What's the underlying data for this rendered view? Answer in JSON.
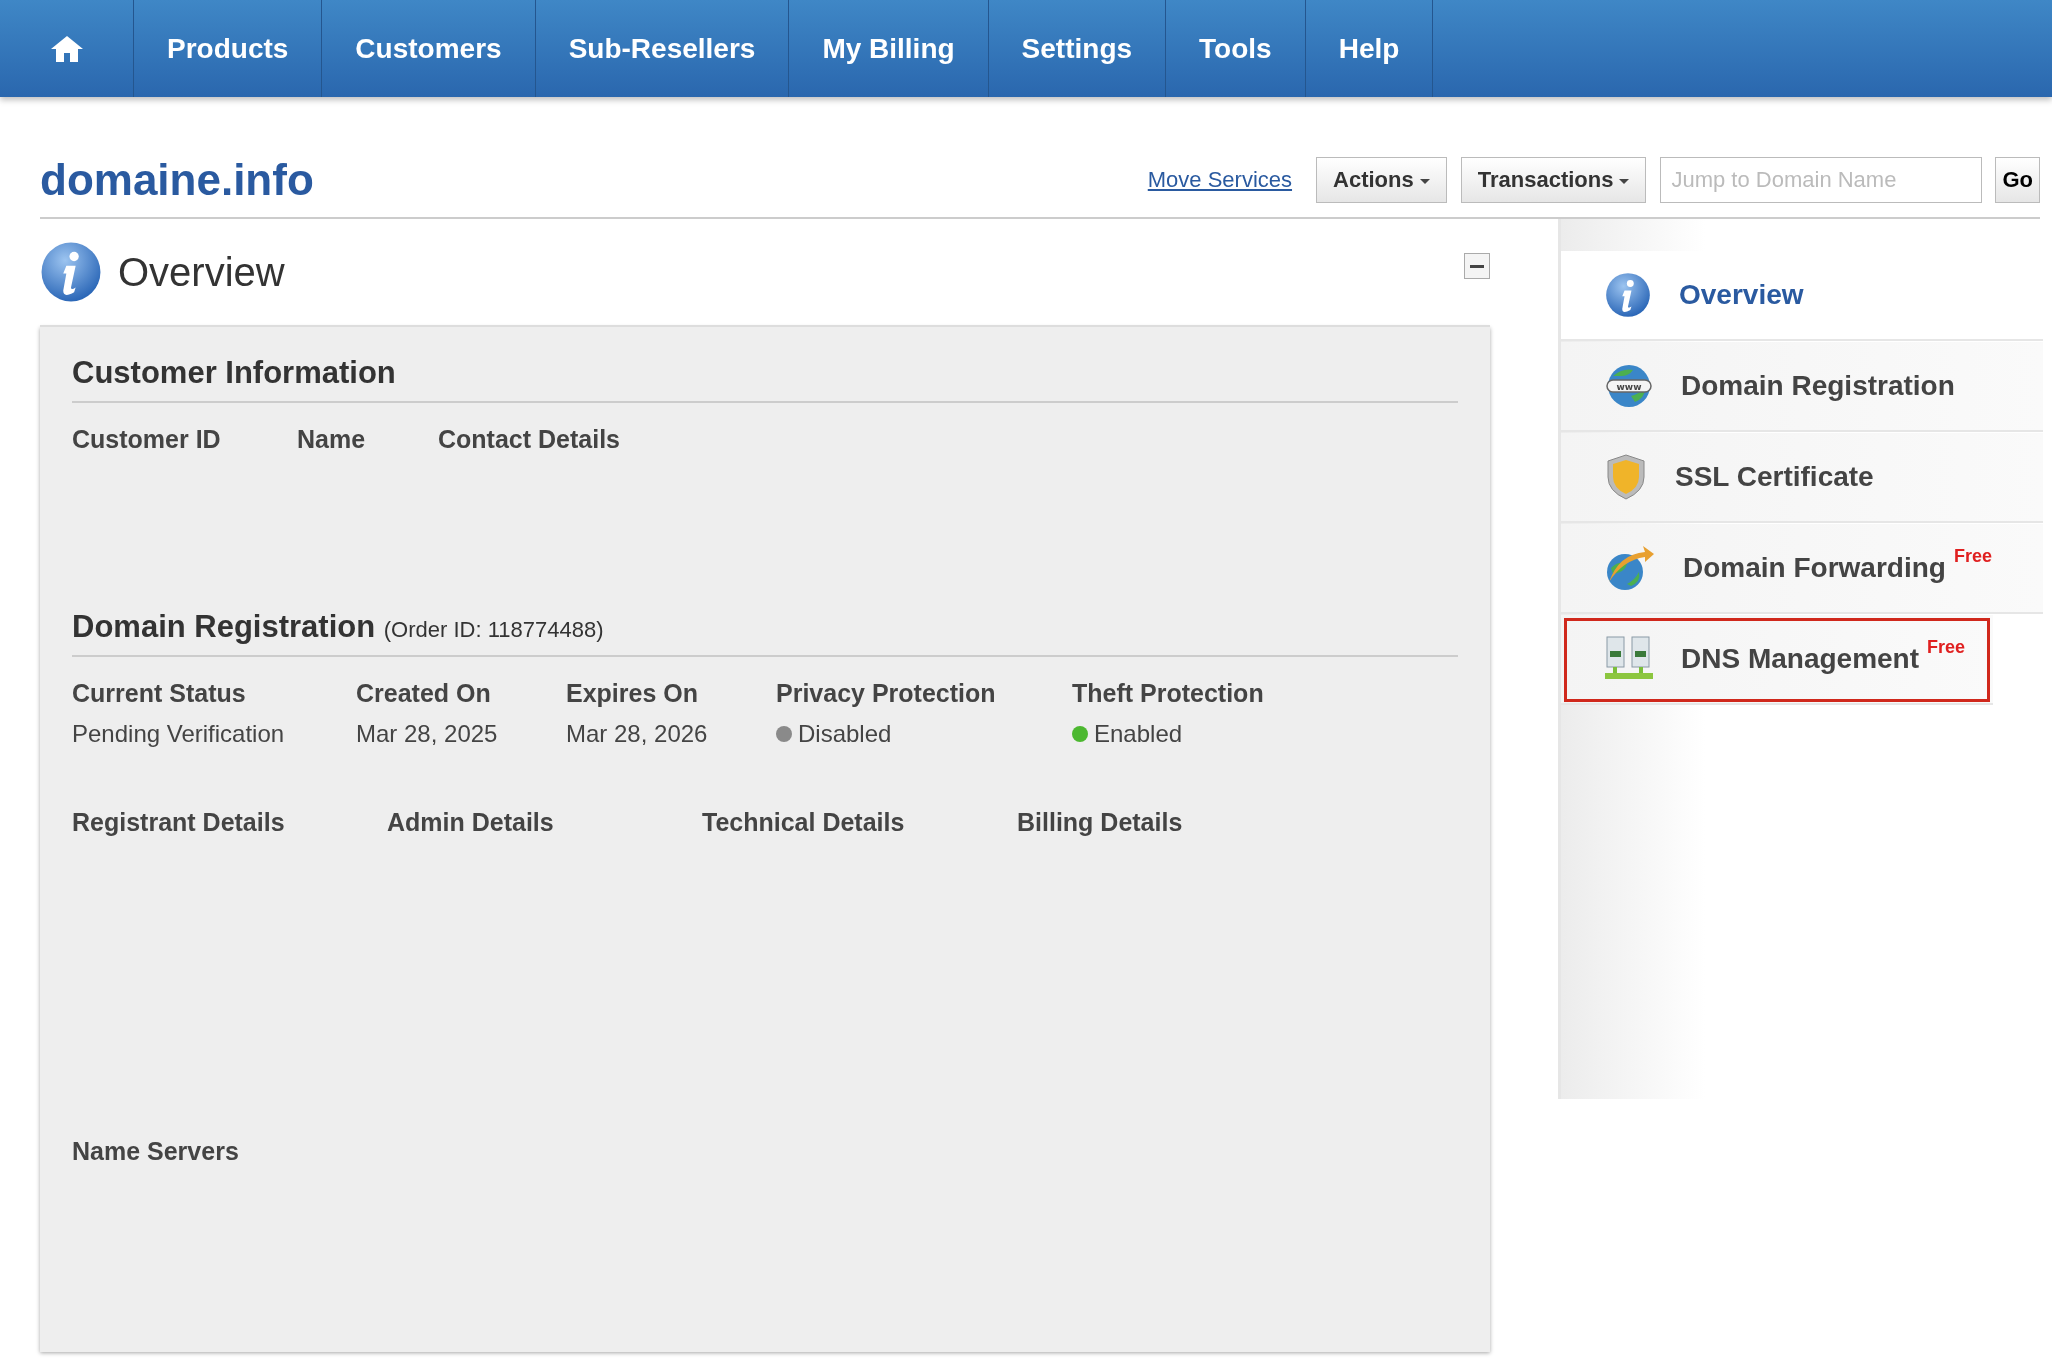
{
  "nav": {
    "items": [
      {
        "label": "Products"
      },
      {
        "label": "Customers"
      },
      {
        "label": "Sub-Resellers"
      },
      {
        "label": "My Billing"
      },
      {
        "label": "Settings"
      },
      {
        "label": "Tools"
      },
      {
        "label": "Help"
      }
    ]
  },
  "header": {
    "title": "domaine.info",
    "link": "Move Services",
    "menus": [
      {
        "label": "Actions"
      },
      {
        "label": "Transactions"
      }
    ],
    "search": {
      "placeholder": "Jump to Domain Name"
    },
    "go": "Go"
  },
  "overview": {
    "title": "Overview"
  },
  "customer_info": {
    "title": "Customer Information",
    "columns": [
      "Customer ID",
      "Name",
      "Contact Details"
    ]
  },
  "domain_registration": {
    "title": "Domain Registration",
    "order_id": "(Order ID: 118774488)",
    "fields": [
      {
        "label": "Current Status",
        "value": "Pending Verification",
        "kind": "text"
      },
      {
        "label": "Created On",
        "value": "Mar 28, 2025",
        "kind": "text"
      },
      {
        "label": "Expires On",
        "value": "Mar 28, 2026",
        "kind": "text"
      },
      {
        "label": "Privacy Protection",
        "value": "Disabled",
        "kind": "status",
        "on": false
      },
      {
        "label": "Theft Protection",
        "value": "Enabled",
        "kind": "status",
        "on": true
      }
    ],
    "contacts": [
      "Registrant Details",
      "Admin Details",
      "Technical Details",
      "Billing Details"
    ],
    "name_servers": "Name Servers"
  },
  "sidebar": {
    "items": [
      {
        "label": "Overview",
        "kind": "info",
        "selected": true,
        "highlighted": false
      },
      {
        "label": "Domain Registration",
        "kind": "www",
        "selected": false,
        "highlighted": false
      },
      {
        "label": "SSL Certificate",
        "kind": "shield",
        "selected": false,
        "highlighted": false
      },
      {
        "label": "Domain Forwarding",
        "kind": "forward",
        "badge": "Free",
        "selected": false,
        "highlighted": false
      },
      {
        "label": "DNS Management",
        "kind": "dns",
        "badge": "Free",
        "selected": false,
        "highlighted": true
      }
    ]
  }
}
